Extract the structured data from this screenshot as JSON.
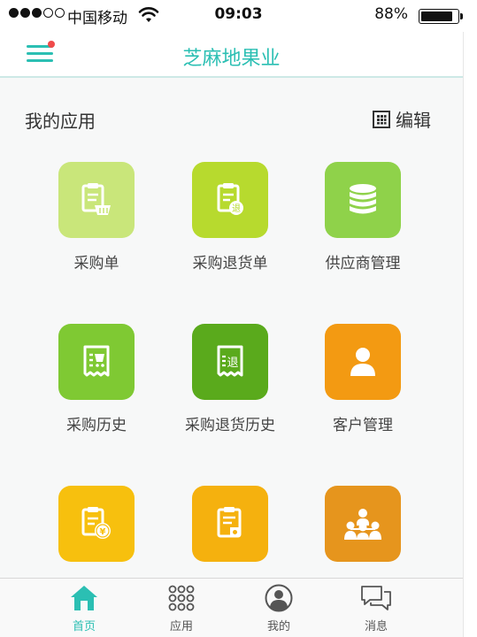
{
  "status_bar": {
    "carrier": "中国移动",
    "time": "09:03",
    "battery": "88%",
    "battery_level": 0.88
  },
  "header": {
    "title": "芝麻地果业",
    "menu_has_badge": true
  },
  "section": {
    "title": "我的应用",
    "edit_label": "编辑"
  },
  "apps": [
    {
      "label": "采购单",
      "icon": "purchase-order-icon",
      "color": "#c9e67a"
    },
    {
      "label": "采购退货单",
      "icon": "purchase-return-order-icon",
      "color": "#b7da2e"
    },
    {
      "label": "供应商管理",
      "icon": "supplier-database-icon",
      "color": "#8fd24a"
    },
    {
      "label": "采购历史",
      "icon": "purchase-history-icon",
      "color": "#7fc933"
    },
    {
      "label": "采购退货历史",
      "icon": "purchase-return-history-icon",
      "color": "#5aaa1c"
    },
    {
      "label": "客户管理",
      "icon": "customer-icon",
      "color": "#f39a12"
    },
    {
      "label": "",
      "icon": "sales-order-icon",
      "color": "#f7c00e"
    },
    {
      "label": "",
      "icon": "sales-return-icon",
      "color": "#f5b10e"
    },
    {
      "label": "",
      "icon": "group-icon",
      "color": "#e6951d"
    }
  ],
  "tabs": [
    {
      "label": "首页",
      "icon": "home-icon",
      "active": true
    },
    {
      "label": "应用",
      "icon": "apps-grid-icon",
      "active": false
    },
    {
      "label": "我的",
      "icon": "profile-icon",
      "active": false
    },
    {
      "label": "消息",
      "icon": "message-icon",
      "active": false
    }
  ],
  "colors": {
    "accent": "#2bbfb3",
    "badge": "#f04a4a"
  }
}
